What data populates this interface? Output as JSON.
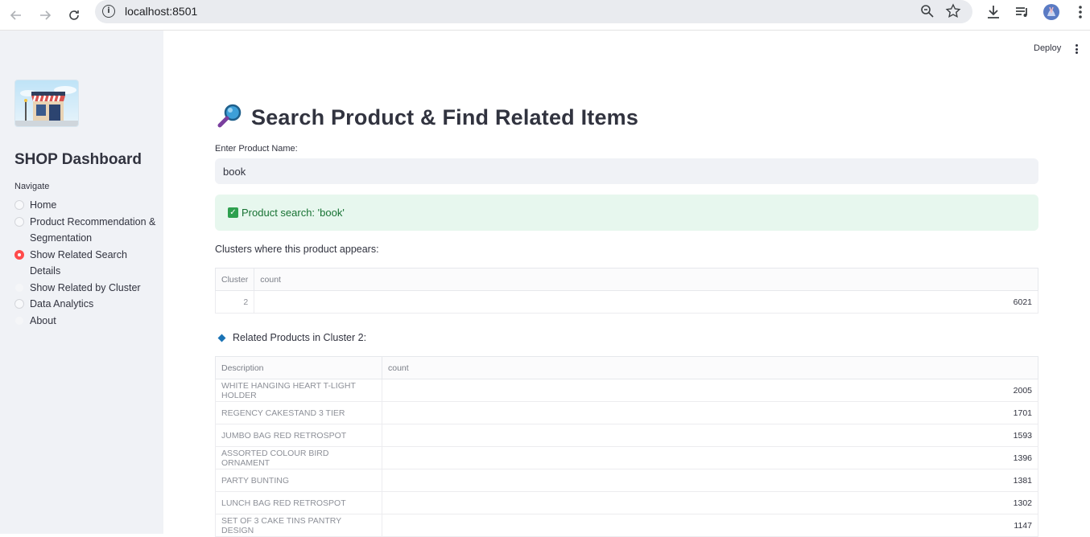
{
  "browser": {
    "url": "localhost:8501"
  },
  "sidebar": {
    "brand": "SHOP Dashboard",
    "nav_label": "Navigate",
    "items": [
      {
        "label": "Home",
        "state": "unchecked"
      },
      {
        "label": "Product Recommendation & Segmentation",
        "state": "unchecked"
      },
      {
        "label": "Show Related Search Details",
        "state": "checked"
      },
      {
        "label": "Show Related by Cluster",
        "state": "faint"
      },
      {
        "label": "Data Analytics",
        "state": "unchecked"
      },
      {
        "label": "About",
        "state": "faint"
      }
    ]
  },
  "header": {
    "deploy_label": "Deploy"
  },
  "main": {
    "title": "Search Product & Find Related Items",
    "input_label": "Enter Product Name:",
    "input_value": "book",
    "success_message": "Product search: 'book'",
    "clusters_caption": "Clusters where this product appears:",
    "clusters_table": {
      "columns": [
        "Cluster",
        "count"
      ],
      "rows": [
        [
          "2",
          "6021"
        ]
      ]
    },
    "related_caption": "Related Products in Cluster 2:",
    "related_table": {
      "columns": [
        "Description",
        "count"
      ],
      "rows": [
        [
          "WHITE HANGING HEART T-LIGHT HOLDER",
          "2005"
        ],
        [
          "REGENCY CAKESTAND 3 TIER",
          "1701"
        ],
        [
          "JUMBO BAG RED RETROSPOT",
          "1593"
        ],
        [
          "ASSORTED COLOUR BIRD ORNAMENT",
          "1396"
        ],
        [
          "PARTY BUNTING",
          "1381"
        ],
        [
          "LUNCH BAG RED RETROSPOT",
          "1302"
        ],
        [
          "SET OF 3 CAKE TINS PANTRY DESIGN",
          "1147"
        ]
      ]
    }
  },
  "colors": {
    "accent": "#ff4b4b",
    "success_bg": "#e7f7ee",
    "success_text": "#177233",
    "sidebar_bg": "#f0f2f6"
  }
}
